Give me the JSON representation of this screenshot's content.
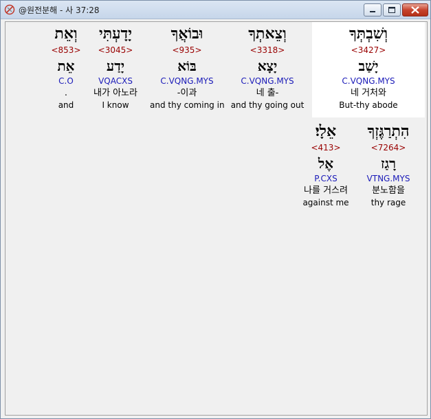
{
  "window": {
    "title": "@원전분해 - 사 37:28"
  },
  "rows": [
    [
      {
        "hebrew": "וְשִׁבְתְּךָ",
        "strong": "<3427>",
        "lemma": "יָשַׁב",
        "morph": "C.VQNG.MYS",
        "korean": "네 거처와",
        "english": "But-thy abode",
        "highlighted": true
      },
      {
        "hebrew": "וְצֵאתְךָ",
        "strong": "<3318>",
        "lemma": "יָצָא",
        "morph": "C.VQNG.MYS",
        "korean": "네 출-",
        "english": "and thy going out",
        "highlighted": false
      },
      {
        "hebrew": "וּבוֹאֲךָ",
        "strong": "<935>",
        "lemma": "בּוֹא",
        "morph": "C.VQNG.MYS",
        "korean": "-이과",
        "english": "and thy coming in",
        "highlighted": false
      },
      {
        "hebrew": "יָדָעְתִּי",
        "strong": "<3045>",
        "lemma": "יָדַע",
        "morph": "VQACXS",
        "korean": "내가 아노라",
        "english": "I know",
        "highlighted": false
      },
      {
        "hebrew": "וְאֵת",
        "strong": "<853>",
        "lemma": "אֵת",
        "morph": "C.O",
        "korean": ".",
        "english": "and",
        "highlighted": false
      }
    ],
    [
      {
        "hebrew": "הִתְרַגֶּזְךָ",
        "strong": "<7264>",
        "lemma": "רָגַז",
        "morph": "VTNG.MYS",
        "korean": "분노함을",
        "english": "thy rage",
        "highlighted": false
      },
      {
        "hebrew": "אֵלָי׃",
        "strong": "<413>",
        "lemma": "אֶל",
        "morph": "P.CXS",
        "korean": "나를 거스려",
        "english": "against me",
        "highlighted": false
      }
    ]
  ],
  "colors": {
    "strong": "#990000",
    "morph": "#1a1ab8",
    "highlight": "#ffffff"
  }
}
